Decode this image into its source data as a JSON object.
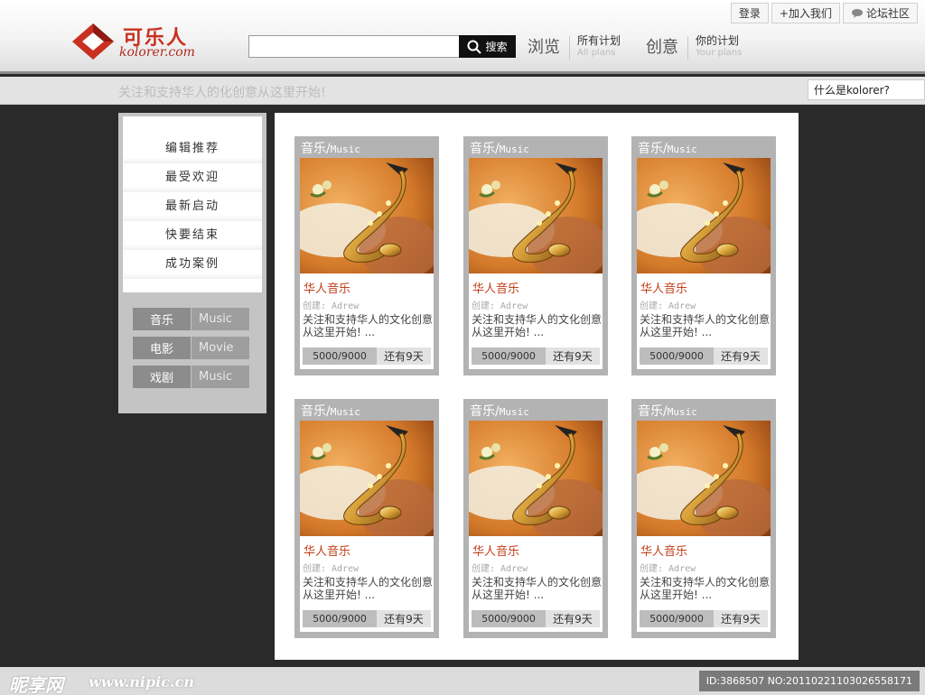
{
  "brand": {
    "name_cn": "可乐人",
    "name_en": "kolorer.com"
  },
  "search": {
    "value": "",
    "placeholder": "",
    "button_label": "搜索"
  },
  "nav": {
    "browse_label": "浏览",
    "all_plans": {
      "cn": "所有计划",
      "en": "All plans"
    },
    "create_label": "创意",
    "your_plans": {
      "cn": "你的计划",
      "en": "Your plans"
    }
  },
  "top_links": {
    "login": "登录",
    "join": "+加入我们",
    "forum": "论坛社区"
  },
  "slogan": "关注和支持华人的化创意从这里开始!",
  "what_is": "什么是kolorer?",
  "sidebar": {
    "menu": [
      "编辑推荐",
      "最受欢迎",
      "最新启动",
      "快要结束",
      "成功案例"
    ],
    "categories": [
      {
        "cn": "音乐",
        "en": "Music"
      },
      {
        "cn": "电影",
        "en": "Movie"
      },
      {
        "cn": "戏剧",
        "en": "Music"
      }
    ]
  },
  "cards": [
    {
      "cat_cn": "音乐/",
      "cat_en": "Music",
      "title": "华人音乐",
      "creator": "创建: Adrew",
      "desc": "关注和支持华人的文化创意从这里开始! ...",
      "progress": "5000/9000",
      "remain": "还有9天",
      "funded_fraction": 0.556
    },
    {
      "cat_cn": "音乐/",
      "cat_en": "Music",
      "title": "华人音乐",
      "creator": "创建: Adrew",
      "desc": "关注和支持华人的文化创意从这里开始! ...",
      "progress": "5000/9000",
      "remain": "还有9天",
      "funded_fraction": 0.556
    },
    {
      "cat_cn": "音乐/",
      "cat_en": "Music",
      "title": "华人音乐",
      "creator": "创建: Adrew",
      "desc": "关注和支持华人的文化创意从这里开始! ...",
      "progress": "5000/9000",
      "remain": "还有9天",
      "funded_fraction": 0.556
    },
    {
      "cat_cn": "音乐/",
      "cat_en": "Music",
      "title": "华人音乐",
      "creator": "创建: Adrew",
      "desc": "关注和支持华人的文化创意从这里开始! ...",
      "progress": "5000/9000",
      "remain": "还有9天",
      "funded_fraction": 0.556
    },
    {
      "cat_cn": "音乐/",
      "cat_en": "Music",
      "title": "华人音乐",
      "creator": "创建: Adrew",
      "desc": "关注和支持华人的文化创意从这里开始! ...",
      "progress": "5000/9000",
      "remain": "还有9天",
      "funded_fraction": 0.556
    },
    {
      "cat_cn": "音乐/",
      "cat_en": "Music",
      "title": "华人音乐",
      "creator": "创建: Adrew",
      "desc": "关注和支持华人的文化创意从这里开始! ...",
      "progress": "5000/9000",
      "remain": "还有9天",
      "funded_fraction": 0.556
    }
  ],
  "watermark": {
    "logo": "昵享网",
    "url": "www.nipic.cn",
    "id": "ID:3868507 NO:20110221103026558171"
  },
  "colors": {
    "accent": "#c3401b",
    "brand": "#c8301f",
    "dark_bg": "#2a2a2a"
  },
  "icons": {
    "logo": "diamond-logo-icon",
    "search": "search-icon",
    "forum": "chat-bubble-icon",
    "card_image": "saxophone-image"
  }
}
